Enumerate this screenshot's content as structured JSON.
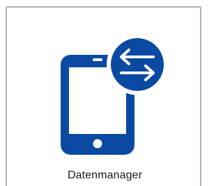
{
  "tile": {
    "label": "Datenmanager",
    "icon": "tablet-sync-icon"
  },
  "colors": {
    "icon_blue": "#0b4aa2",
    "border": "#b2b2b2",
    "text": "#1a1a1a",
    "background": "#ffffff"
  }
}
